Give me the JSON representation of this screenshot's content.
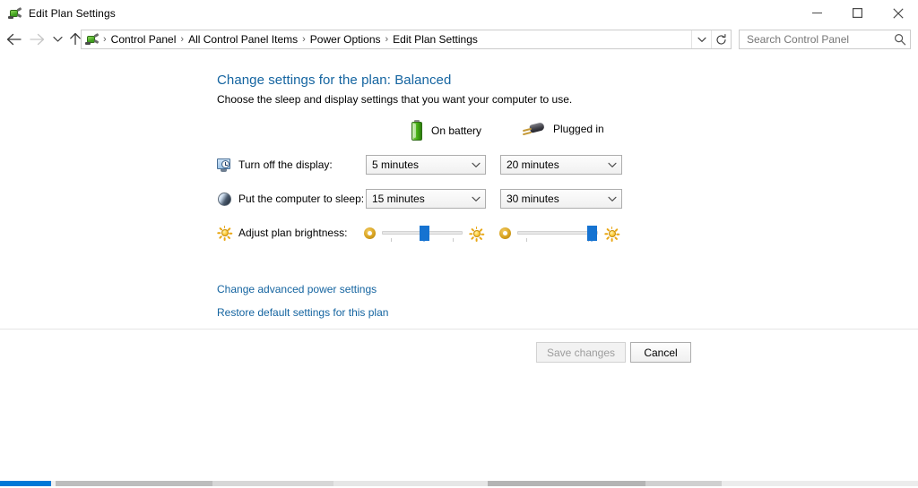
{
  "window": {
    "title": "Edit Plan Settings",
    "icon": "power-plug-icon",
    "controls": {
      "minimize": "Minimize",
      "maximize": "Maximize",
      "close": "Close"
    }
  },
  "navbar": {
    "back_tooltip": "Back",
    "forward_tooltip": "Forward",
    "recent_tooltip": "Recent locations",
    "up_tooltip": "Up one level",
    "breadcrumbs": [
      "Control Panel",
      "All Control Panel Items",
      "Power Options",
      "Edit Plan Settings"
    ],
    "separator": "›",
    "dropdown_tooltip": "Previous locations",
    "refresh_tooltip": "Refresh"
  },
  "search": {
    "placeholder": "Search Control Panel",
    "value": "",
    "icon": "search-icon"
  },
  "page": {
    "title": "Change settings for the plan: Balanced",
    "subtitle": "Choose the sleep and display settings that you want your computer to use."
  },
  "columns": [
    {
      "id": "battery",
      "label": "On battery",
      "icon": "battery-icon"
    },
    {
      "id": "plugged",
      "label": "Plugged in",
      "icon": "power-plug-icon"
    }
  ],
  "settings": [
    {
      "id": "turn-off-display",
      "icon": "display-clock-icon",
      "label": "Turn off the display:",
      "battery_value": "5 minutes",
      "plugged_value": "20 minutes"
    },
    {
      "id": "sleep",
      "icon": "moon-icon",
      "label": "Put the computer to sleep:",
      "battery_value": "15 minutes",
      "plugged_value": "30 minutes"
    }
  ],
  "brightness": {
    "icon": "sun-icon",
    "label": "Adjust plan brightness:",
    "low_icon": "dim-brightness-icon",
    "high_icon": "bright-brightness-icon",
    "battery_percent": 52,
    "plugged_percent": 92
  },
  "links": [
    {
      "id": "advanced",
      "label": "Change advanced power settings"
    },
    {
      "id": "restore",
      "label": "Restore default settings for this plan"
    }
  ],
  "footer": {
    "save_label": "Save changes",
    "save_enabled": false,
    "cancel_label": "Cancel",
    "cancel_enabled": true
  },
  "colors": {
    "link": "#1464a0",
    "heading": "#1464a0",
    "accent_slider": "#1673d1",
    "battery_green": "#46ad16",
    "taskbar_active": "#0078d7",
    "disabled_text": "#9d9d9d"
  }
}
